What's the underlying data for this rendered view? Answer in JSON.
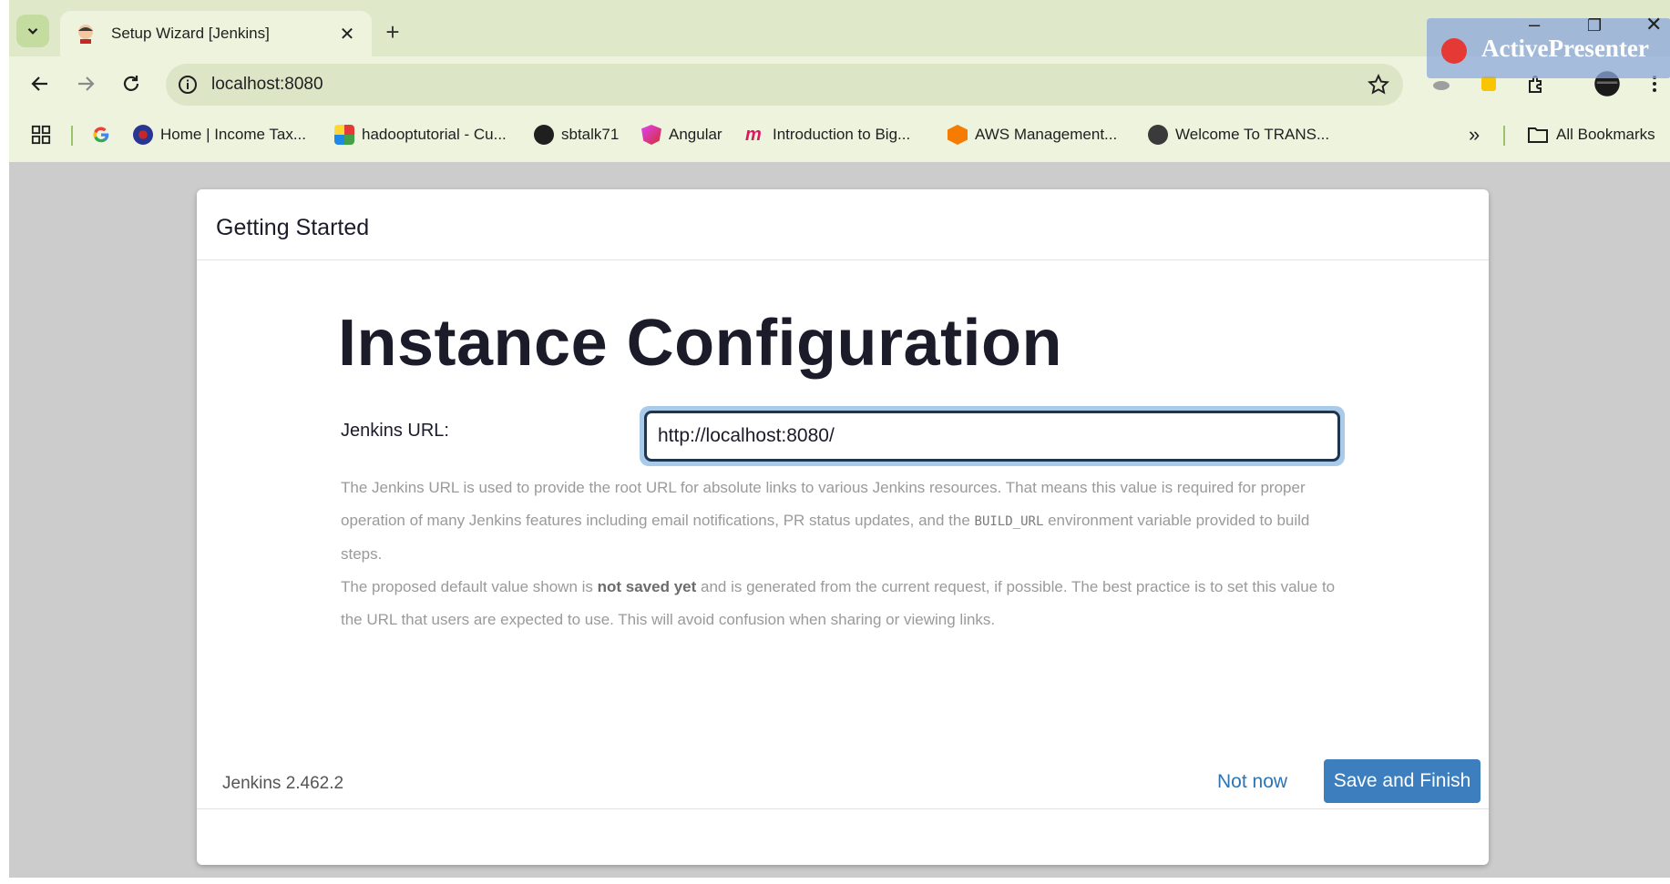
{
  "browser": {
    "tab": {
      "title": "Setup Wizard [Jenkins]"
    },
    "address": {
      "url": "localhost:8080"
    },
    "bookmarks": [
      {
        "label": "Home | Income Tax...",
        "icon": "income-tax-icon"
      },
      {
        "label": "hadooptutorial - Cu...",
        "icon": "hadoop-icon"
      },
      {
        "label": "sbtalk71",
        "icon": "github-icon"
      },
      {
        "label": "Angular",
        "icon": "angular-icon"
      },
      {
        "label": "Introduction to Big...",
        "icon": "m-logo-icon"
      },
      {
        "label": "AWS Management...",
        "icon": "aws-icon"
      },
      {
        "label": "Welcome To TRANS...",
        "icon": "globe-icon"
      }
    ],
    "all_bookmarks_label": "All Bookmarks"
  },
  "overlay": {
    "label": "ActivePresenter"
  },
  "card": {
    "header": "Getting Started",
    "heading": "Instance Configuration",
    "field_label": "Jenkins URL:",
    "field_value": "http://localhost:8080/",
    "help1_a": "The Jenkins URL is used to provide the root URL for absolute links to various Jenkins resources. That means this value is required for proper operation of many Jenkins features including email notifications, PR status updates, and the ",
    "help1_code": "BUILD_URL",
    "help1_b": " environment variable provided to build steps.",
    "help2_a": "The proposed default value shown is ",
    "help2_bold": "not saved yet",
    "help2_b": " and is generated from the current request, if possible. The best practice is to set this value to the URL that users are expected to use. This will avoid confusion when sharing or viewing links.",
    "version": "Jenkins 2.462.2",
    "not_now": "Not now",
    "save_finish": "Save and Finish"
  },
  "colors": {
    "accent": "#3d7fbe",
    "link": "#2b75b5",
    "chrome": "#eef3de",
    "tabstrip": "#dfe8c8"
  }
}
